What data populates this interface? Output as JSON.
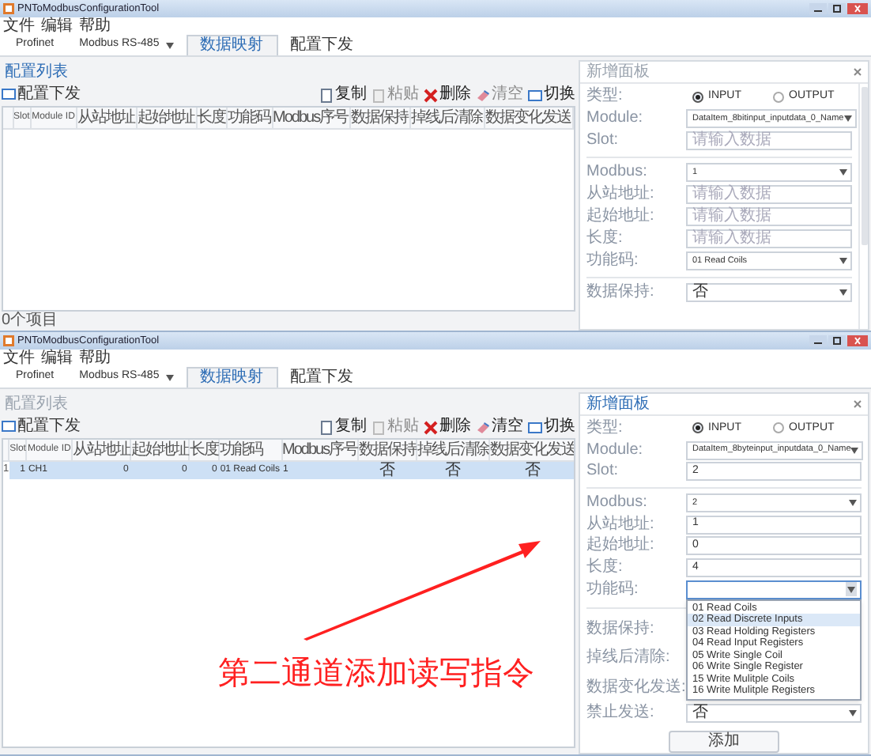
{
  "windows": [
    {
      "title": "PNToModbusConfigurationTool",
      "menu": [
        "文件",
        "编辑",
        "帮助"
      ],
      "tabs": [
        {
          "label": "Profinet",
          "selected": false,
          "has_menu": false
        },
        {
          "label": "Modbus RS-485",
          "selected": false,
          "has_menu": true
        },
        {
          "label": "数据映射",
          "selected": true,
          "has_menu": false
        },
        {
          "label": "配置下发",
          "selected": false,
          "has_menu": false
        }
      ],
      "list_title": {
        "text": "配置列表",
        "highlighted": true
      },
      "upload_button": "配置下发",
      "toolbar": [
        {
          "label": "复制",
          "kind": "copy",
          "disabled": false
        },
        {
          "label": "粘贴",
          "kind": "paste",
          "disabled": true
        },
        {
          "label": "删除",
          "kind": "delete",
          "disabled": false
        },
        {
          "label": "清空",
          "kind": "clear",
          "disabled": true
        },
        {
          "label": "切换",
          "kind": "switch",
          "disabled": false
        }
      ],
      "table": {
        "columns": [
          "Slot",
          "Module ID",
          "从站地址",
          "起始地址",
          "长度",
          "功能码",
          "Modbus序号",
          "数据保持",
          "掉线后清除",
          "数据变化发送"
        ]
      },
      "status_bar": "0个项目",
      "panel": {
        "title": "新增面板",
        "highlighted": false,
        "fields": [
          {
            "kind": "radio",
            "label": "类型:",
            "options": [
              {
                "label": "INPUT",
                "selected": true
              },
              {
                "label": "OUTPUT",
                "selected": false
              }
            ]
          },
          {
            "kind": "select",
            "label": "Module:",
            "value": "DataItem_8bitinput_inputdata_0_Name"
          },
          {
            "kind": "input",
            "label": "Slot:",
            "placeholder": "请输入数据"
          },
          {
            "kind": "divider"
          },
          {
            "kind": "select",
            "label": "Modbus:",
            "value": "1"
          },
          {
            "kind": "input",
            "label": "从站地址:",
            "placeholder": "请输入数据"
          },
          {
            "kind": "input",
            "label": "起始地址:",
            "placeholder": "请输入数据"
          },
          {
            "kind": "input",
            "label": "长度:",
            "placeholder": "请输入数据"
          },
          {
            "kind": "select",
            "label": "功能码:",
            "value": "01 Read Coils"
          },
          {
            "kind": "divider"
          },
          {
            "kind": "select",
            "label": "数据保持:",
            "value": "否"
          }
        ]
      }
    },
    {
      "title": "PNToModbusConfigurationTool",
      "menu": [
        "文件",
        "编辑",
        "帮助"
      ],
      "tabs": [
        {
          "label": "Profinet",
          "selected": false,
          "has_menu": false
        },
        {
          "label": "Modbus RS-485",
          "selected": false,
          "has_menu": true
        },
        {
          "label": "数据映射",
          "selected": true,
          "has_menu": false
        },
        {
          "label": "配置下发",
          "selected": false,
          "has_menu": false
        }
      ],
      "list_title": {
        "text": "配置列表",
        "highlighted": false
      },
      "upload_button": "配置下发",
      "toolbar": [
        {
          "label": "复制",
          "kind": "copy",
          "disabled": false
        },
        {
          "label": "粘贴",
          "kind": "paste",
          "disabled": true
        },
        {
          "label": "删除",
          "kind": "delete",
          "disabled": false
        },
        {
          "label": "清空",
          "kind": "clear",
          "disabled": false
        },
        {
          "label": "切换",
          "kind": "switch",
          "disabled": false
        }
      ],
      "table": {
        "columns": [
          "Slot",
          "Module ID",
          "从站地址",
          "起始地址",
          "长度",
          "功能码",
          "Modbus序号",
          "数据保持",
          "掉线后清除",
          "数据变化发送"
        ],
        "rows": [
          {
            "number": "1",
            "selected": true,
            "cells": [
              "1",
              "CH1",
              "0",
              "0",
              "0",
              "01 Read Coils",
              "1",
              "否",
              "否",
              "否"
            ]
          }
        ]
      },
      "panel": {
        "title": "新增面板",
        "highlighted": true,
        "fields": [
          {
            "kind": "radio",
            "label": "类型:",
            "options": [
              {
                "label": "INPUT",
                "selected": true
              },
              {
                "label": "OUTPUT",
                "selected": false
              }
            ]
          },
          {
            "kind": "select",
            "label": "Module:",
            "value": "DataItem_8byteinput_inputdata_0_Name"
          },
          {
            "kind": "input",
            "label": "Slot:",
            "value": "2"
          },
          {
            "kind": "divider"
          },
          {
            "kind": "select",
            "label": "Modbus:",
            "value": "2"
          },
          {
            "kind": "input",
            "label": "从站地址:",
            "value": "1"
          },
          {
            "kind": "input",
            "label": "起始地址:",
            "value": "0"
          },
          {
            "kind": "input",
            "label": "长度:",
            "value": "4"
          },
          {
            "kind": "select",
            "label": "功能码:",
            "open": true,
            "options": [
              {
                "label": "01 Read Coils",
                "selected": false
              },
              {
                "label": "02 Read Discrete Inputs",
                "selected": true
              },
              {
                "label": "03 Read Holding Registers",
                "selected": false
              },
              {
                "label": "04 Read Input Registers",
                "selected": false
              },
              {
                "label": "05 Write Single Coil",
                "selected": false
              },
              {
                "label": "06 Write Single Register",
                "selected": false
              },
              {
                "label": "15 Write Mulitple Coils",
                "selected": false
              },
              {
                "label": "16 Write Mulitple Registers",
                "selected": false
              }
            ]
          },
          {
            "kind": "divider"
          },
          {
            "kind": "select",
            "label": "数据保持:"
          },
          {
            "kind": "select",
            "label": "掉线后清除:"
          },
          {
            "kind": "select",
            "label": "数据变化发送:"
          },
          {
            "kind": "select",
            "label": "禁止发送:",
            "value": "否"
          }
        ],
        "add_button": "添加"
      }
    }
  ],
  "annotation": {
    "text": "第二通道添加读写指令"
  }
}
